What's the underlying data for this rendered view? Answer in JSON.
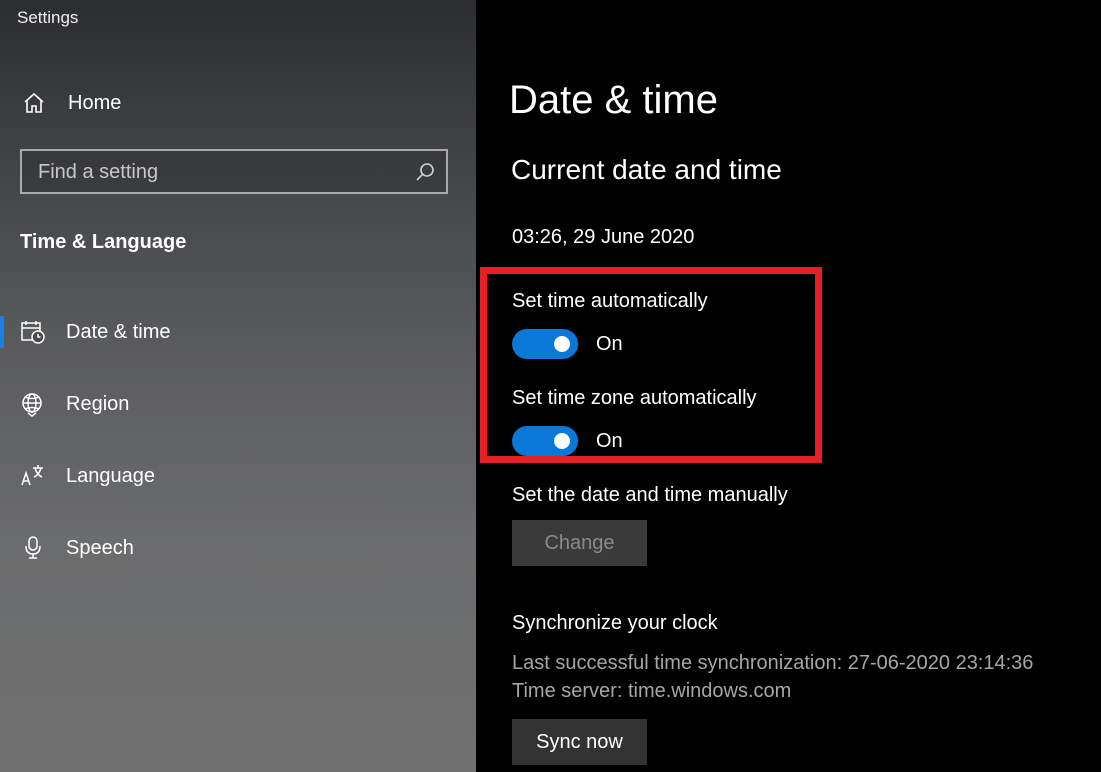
{
  "window": {
    "title": "Settings"
  },
  "sidebar": {
    "home_label": "Home",
    "search_placeholder": "Find a setting",
    "section_title": "Time & Language",
    "items": [
      {
        "label": "Date & time",
        "icon": "calendar-clock-icon",
        "active": true
      },
      {
        "label": "Region",
        "icon": "globe-icon",
        "active": false
      },
      {
        "label": "Language",
        "icon": "language-icon",
        "active": false
      },
      {
        "label": "Speech",
        "icon": "microphone-icon",
        "active": false
      }
    ]
  },
  "main": {
    "page_title": "Date & time",
    "sub_title": "Current date and time",
    "current_datetime": "03:26, 29 June 2020",
    "set_time_auto": {
      "label": "Set time automatically",
      "state": "On"
    },
    "set_timezone_auto": {
      "label": "Set time zone automatically",
      "state": "On"
    },
    "manual": {
      "label": "Set the date and time manually",
      "button": "Change"
    },
    "sync": {
      "title": "Synchronize your clock",
      "last_sync": "Last successful time synchronization: 27-06-2020 23:14:36",
      "time_server": "Time server: time.windows.com",
      "button": "Sync now"
    }
  },
  "colors": {
    "accent": "#0a78d7",
    "highlight": "#e81e25",
    "active_indicator": "#1e7ee0"
  }
}
